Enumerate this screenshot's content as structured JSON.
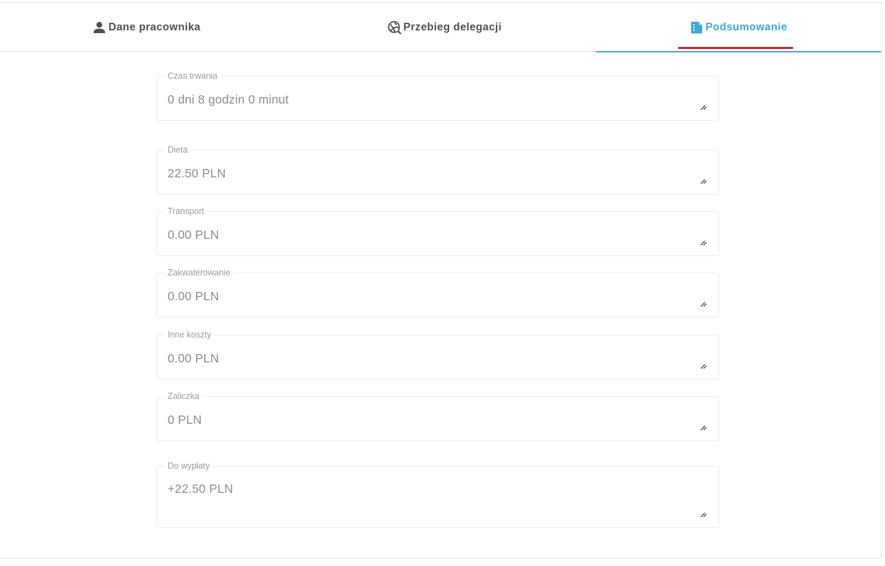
{
  "tabs": [
    {
      "label": "Dane pracownika",
      "icon": "person-icon"
    },
    {
      "label": "Przebieg delegacji",
      "icon": "globe-search-icon"
    },
    {
      "label": "Podsumowanie",
      "icon": "document-icon",
      "active": true
    }
  ],
  "colors": {
    "active_tab": "#3fa6d6",
    "highlight": "#d9202b",
    "inactive_tab": "#505050"
  },
  "fields": [
    {
      "label": "Czas trwania",
      "value": "0 dni 8 godzin 0 minut"
    },
    {
      "label": "Dieta",
      "value": "22.50 PLN"
    },
    {
      "label": "Transport",
      "value": "0.00 PLN"
    },
    {
      "label": "Zakwaterowanie",
      "value": "0.00 PLN"
    },
    {
      "label": "Inne koszty",
      "value": "0.00 PLN"
    },
    {
      "label": "Zaliczka",
      "value": "0 PLN"
    },
    {
      "label": "Do wypłaty",
      "value": "+22.50 PLN"
    }
  ]
}
